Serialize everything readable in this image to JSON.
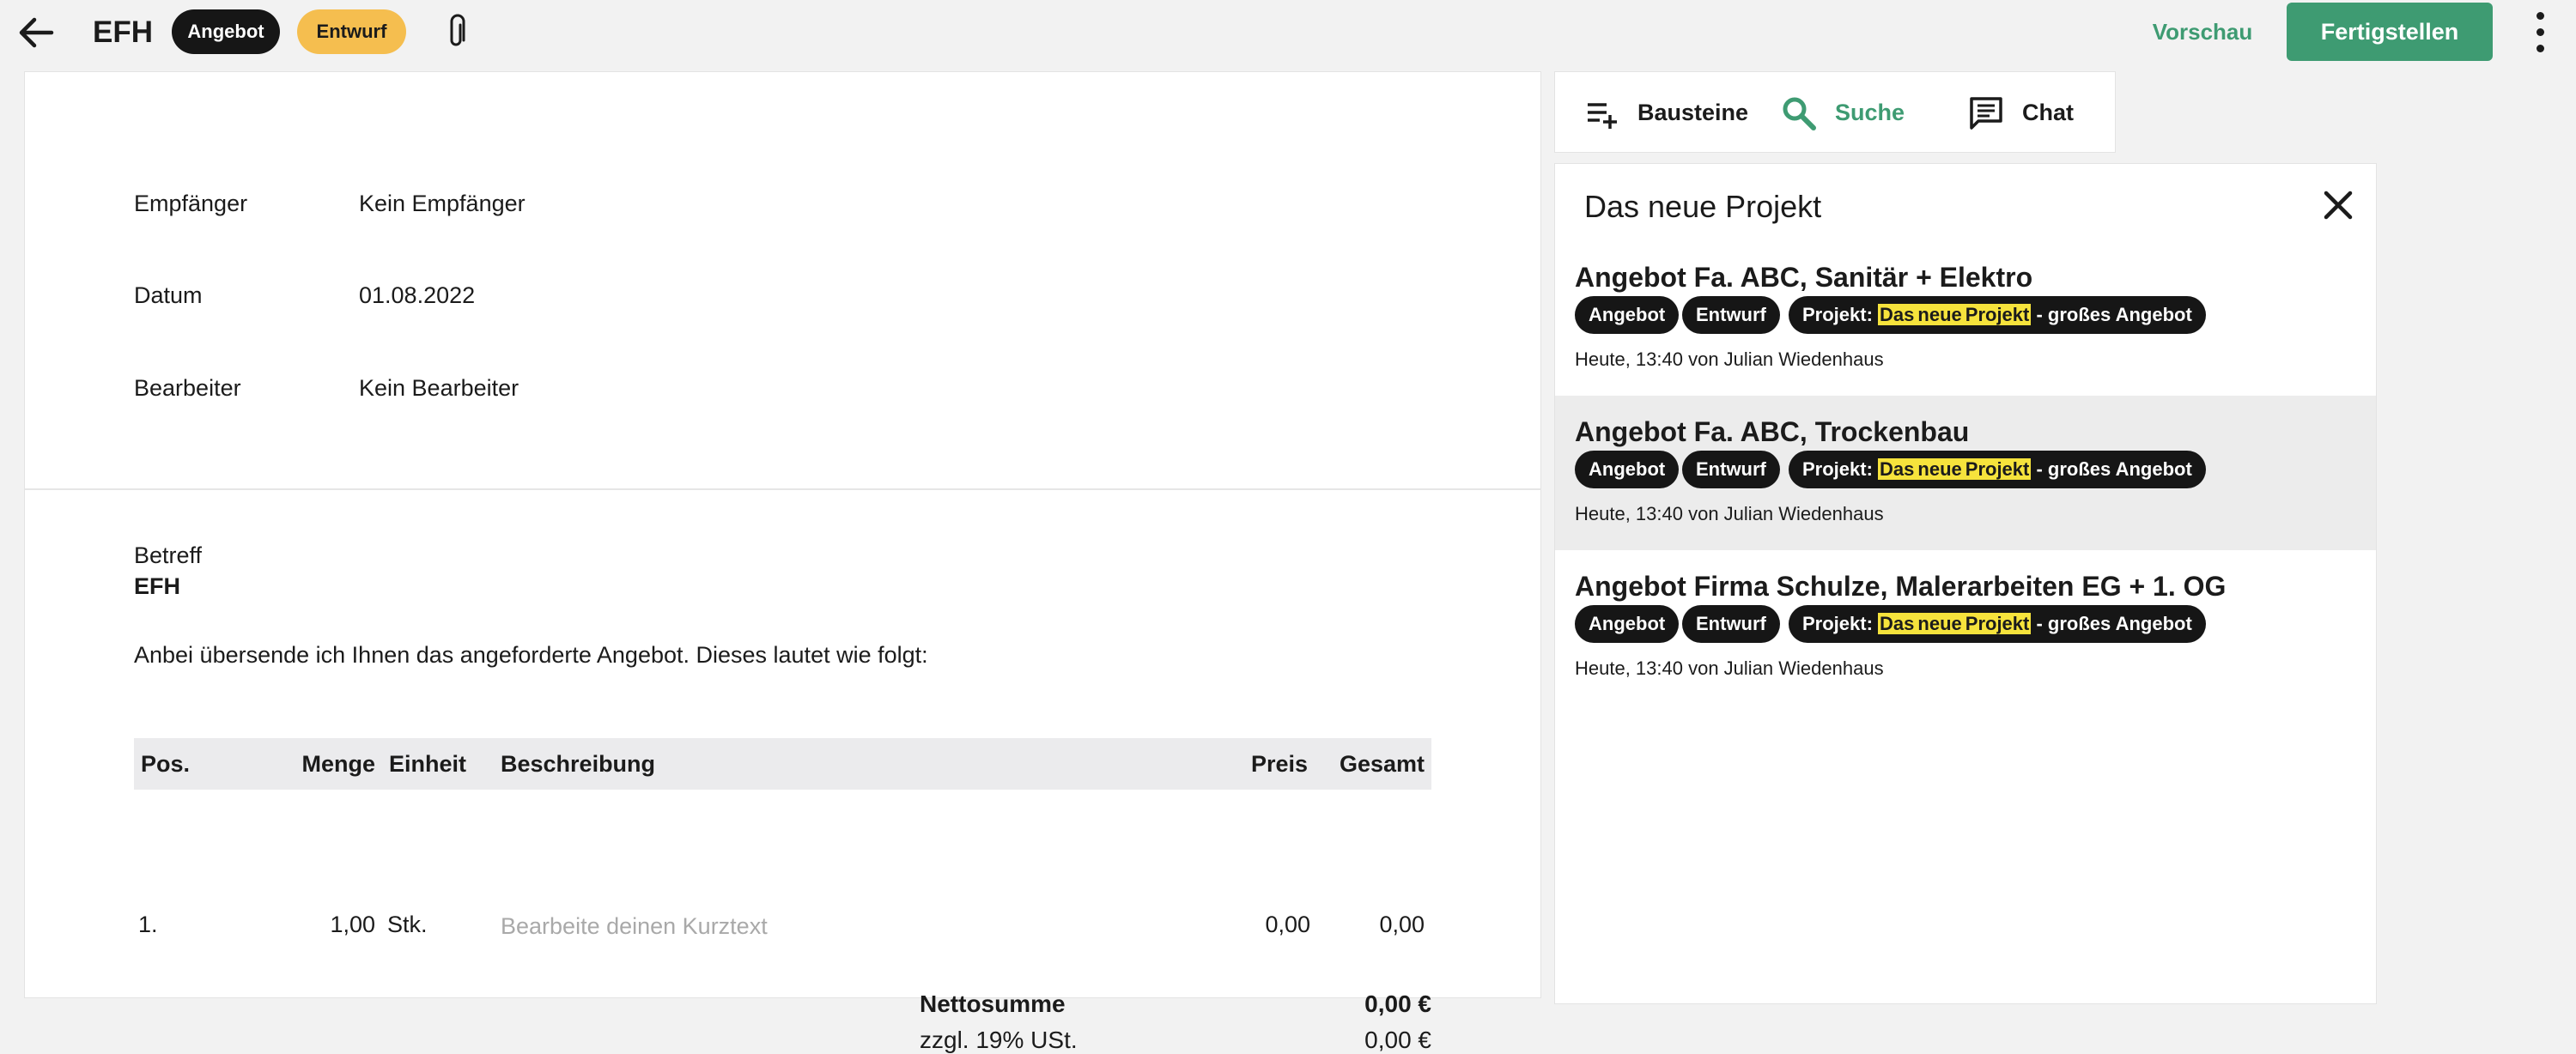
{
  "header": {
    "title": "EFH",
    "badge_type": "Angebot",
    "badge_status": "Entwurf",
    "preview_label": "Vorschau",
    "finish_label": "Fertigstellen"
  },
  "document": {
    "recipient_label": "Empfänger",
    "recipient_value": "Kein Empfänger",
    "date_label": "Datum",
    "date_value": "01.08.2022",
    "editor_label": "Bearbeiter",
    "editor_value": "Kein Bearbeiter",
    "subject_label": "Betreff",
    "subject_value": "EFH",
    "intro_text": "Anbei übersende ich Ihnen das angeforderte Angebot. Dieses lautet wie folgt:",
    "table": {
      "headers": {
        "pos": "Pos.",
        "quantity": "Menge",
        "unit": "Einheit",
        "description": "Beschreibung",
        "price": "Preis",
        "total": "Gesamt"
      },
      "rows": [
        {
          "pos": "1.",
          "quantity": "1,00",
          "unit": "Stk.",
          "description_placeholder": "Bearbeite deinen Kurztext",
          "price": "0,00",
          "total": "0,00"
        }
      ]
    },
    "net_sum_label": "Nettosumme",
    "net_sum_value": "0,00 €",
    "vat_label": "zzgl. 19% USt.",
    "vat_value": "0,00 €"
  },
  "tools": {
    "tabs": [
      {
        "label": "Bausteine",
        "icon": "playlist-add-icon",
        "active": false
      },
      {
        "label": "Suche",
        "icon": "search-icon",
        "active": true
      },
      {
        "label": "Chat",
        "icon": "chat-icon",
        "active": false
      }
    ]
  },
  "search_panel": {
    "title": "Das neue Projekt",
    "results": [
      {
        "title": "Angebot Fa. ABC, Sanitär + Elektro",
        "tag_type": "Angebot",
        "tag_status": "Entwurf",
        "project_prefix": "Projekt:",
        "project_match_1": "Das",
        "project_match_2": "neue",
        "project_match_3": "Projekt",
        "project_suffix": "- großes Angebot",
        "meta": "Heute, 13:40 von Julian Wiedenhaus"
      },
      {
        "title": "Angebot Fa. ABC, Trockenbau",
        "tag_type": "Angebot",
        "tag_status": "Entwurf",
        "project_prefix": "Projekt:",
        "project_match_1": "Das",
        "project_match_2": "neue",
        "project_match_3": "Projekt",
        "project_suffix": "- großes Angebot",
        "meta": "Heute, 13:40 von Julian Wiedenhaus"
      },
      {
        "title": "Angebot Firma Schulze, Malerarbeiten EG + 1. OG",
        "tag_type": "Angebot",
        "tag_status": "Entwurf",
        "project_prefix": "Projekt:",
        "project_match_1": "Das",
        "project_match_2": "neue",
        "project_match_3": "Projekt",
        "project_suffix": "- großes Angebot",
        "meta": "Heute, 13:40 von Julian Wiedenhaus"
      }
    ]
  },
  "colors": {
    "accent_green": "#3e9b72",
    "badge_yellow": "#f5be4f",
    "highlight_yellow": "#f6e33c",
    "chip_dark": "#161616"
  }
}
